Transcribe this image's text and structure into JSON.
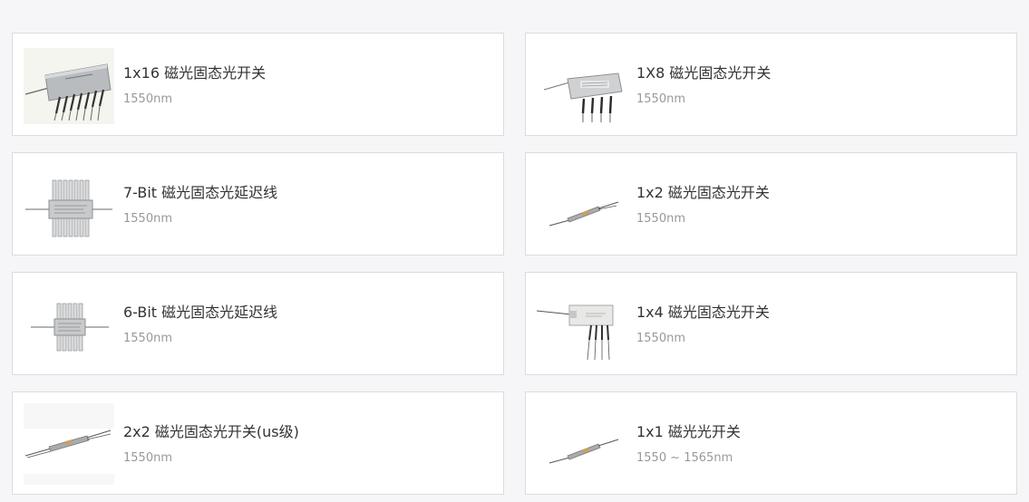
{
  "products": [
    {
      "title": "1x16 磁光固态光开关",
      "spec": "1550nm",
      "image": "1x16-optical-switch-photo"
    },
    {
      "title": "1X8 磁光固态光开关",
      "spec": "1550nm",
      "image": "1x8-optical-switch-photo"
    },
    {
      "title": "7-Bit 磁光固态光延迟线",
      "spec": "1550nm",
      "image": "7bit-delay-line-photo"
    },
    {
      "title": "1x2 磁光固态光开关",
      "spec": "1550nm",
      "image": "1x2-optical-switch-photo"
    },
    {
      "title": "6-Bit 磁光固态光延迟线",
      "spec": "1550nm",
      "image": "6bit-delay-line-photo"
    },
    {
      "title": "1x4 磁光固态光开关",
      "spec": "1550nm",
      "image": "1x4-optical-switch-photo"
    },
    {
      "title": "2x2 磁光固态光开关(us级)",
      "spec": "1550nm",
      "image": "2x2-optical-switch-photo"
    },
    {
      "title": "1x1 磁光光开关",
      "spec": "1550 ~ 1565nm",
      "image": "1x1-optical-switch-photo"
    }
  ]
}
